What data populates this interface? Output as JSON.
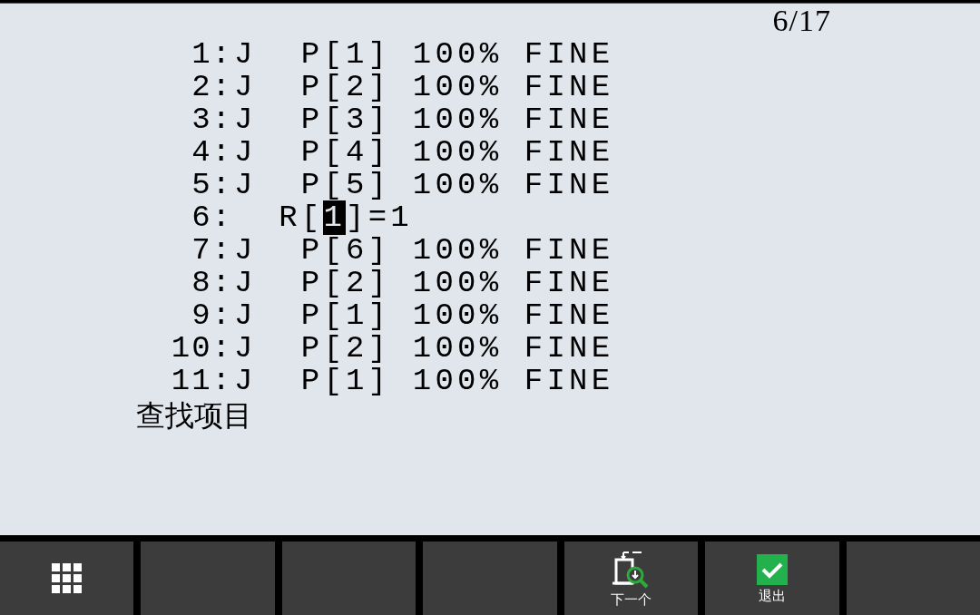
{
  "position": "6/17",
  "lines": [
    {
      "number": "1:",
      "text": "J  P[1] 100% FINE"
    },
    {
      "number": "2:",
      "text": "J  P[2] 100% FINE"
    },
    {
      "number": "3:",
      "text": "J  P[3] 100% FINE"
    },
    {
      "number": "4:",
      "text": "J  P[4] 100% FINE"
    },
    {
      "number": "5:",
      "text": "J  P[5] 100% FINE"
    },
    {
      "number": "6:",
      "text": "  R[",
      "cursor": "1",
      "text_after": "]=1"
    },
    {
      "number": "7:",
      "text": "J  P[6] 100% FINE"
    },
    {
      "number": "8:",
      "text": "J  P[2] 100% FINE"
    },
    {
      "number": "9:",
      "text": "J  P[1] 100% FINE"
    },
    {
      "number": "10:",
      "text": "J  P[2] 100% FINE"
    },
    {
      "number": "11:",
      "text": "J  P[1] 100% FINE"
    }
  ],
  "prompt": "查找项目",
  "function_keys": [
    {
      "kind": "menu"
    },
    {
      "kind": "blank"
    },
    {
      "kind": "blank"
    },
    {
      "kind": "blank"
    },
    {
      "kind": "next",
      "label": "下一个"
    },
    {
      "kind": "exit",
      "label": "退出"
    },
    {
      "kind": "blank"
    }
  ]
}
